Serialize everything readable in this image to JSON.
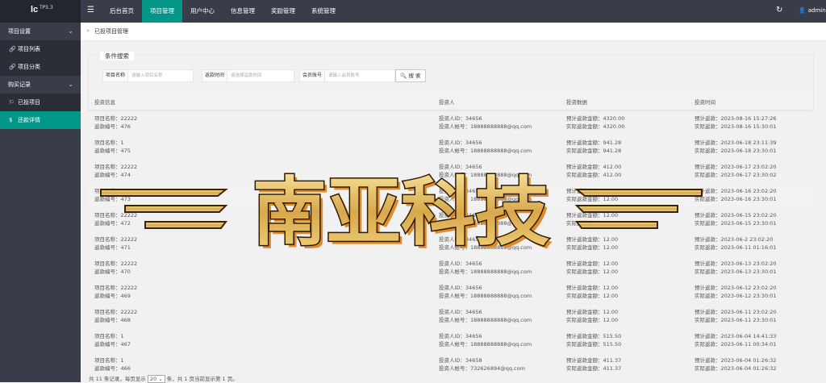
{
  "logo": {
    "text": "lc",
    "version": "TP5.3"
  },
  "nav": {
    "items": [
      "后台首页",
      "项目管理",
      "用户中心",
      "信息管理",
      "奖励管理",
      "系统管理"
    ],
    "active": 1
  },
  "user": {
    "name": "admin"
  },
  "sidebar": {
    "groups": [
      {
        "label": "项目设置"
      },
      {
        "label": "购买记录"
      }
    ],
    "items": [
      {
        "label": "项目列表",
        "icon": "link-icon"
      },
      {
        "label": "项目分类",
        "icon": "link-icon"
      },
      {
        "label": "已投项目",
        "icon": "flag-icon"
      },
      {
        "label": "还款详情",
        "icon": "dollar-circle-icon"
      }
    ],
    "active_item": 3
  },
  "breadcrumb": {
    "separator": "»",
    "text": "已投项目管理"
  },
  "search": {
    "legend": "条件搜索",
    "fields": [
      {
        "label": "项目名称",
        "placeholder": "请输入项目名称"
      },
      {
        "label": "返款时间",
        "placeholder": "请选择返款时间"
      },
      {
        "label": "会员账号",
        "placeholder": "请输入会员账号"
      }
    ],
    "button": "搜 索"
  },
  "table": {
    "headers": [
      "投资信息",
      "投资人",
      "投资数据",
      "投资时间"
    ],
    "rows": [
      {
        "name": "项目名称：22222",
        "no": "返款编号：476",
        "uid": "投资人ID：34656",
        "acct": "投资人帐号：18888888888@qq.com",
        "exp": "预计返款金额：4320.00",
        "act": "实际返款金额：4320.00",
        "et": "预计返款：2023-08-16 15:27:26",
        "at": "实际返款：2023-08-16 15:30:01"
      },
      {
        "name": "项目名称：1",
        "no": "返款编号：475",
        "uid": "投资人ID：34656",
        "acct": "投资人帐号：18888888888@qq.com",
        "exp": "预计返款金额：941.28",
        "act": "实际返款金额：941.28",
        "et": "预计返款：2023-06-18 23:11:39",
        "at": "实际返款：2023-06-18 23:30:01"
      },
      {
        "name": "项目名称：22222",
        "no": "返款编号：474",
        "uid": "投资人ID：34656",
        "acct": "投资人帐号：18888888888@qq.com",
        "exp": "预计返款金额：412.00",
        "act": "实际返款金额：412.00",
        "et": "预计返款：2023-06-17 23:02:20",
        "at": "实际返款：2023-06-17 23:30:02"
      },
      {
        "name": "项目名称：22222",
        "no": "返款编号：473",
        "uid": "投资人ID：34656",
        "acct": "投资人帐号：18888888888@qq.com",
        "exp": "预计返款金额：12.00",
        "act": "实际返款金额：12.00",
        "et": "预计返款：2023-06-16 23:02:20",
        "at": "实际返款：2023-06-16 23:30:01"
      },
      {
        "name": "项目名称：22222",
        "no": "返款编号：472",
        "uid": "投资人ID：34656",
        "acct": "投资人帐号：18888888888@qq.com",
        "exp": "预计返款金额：12.00",
        "act": "实际返款金额：12.00",
        "et": "预计返款：2023-06-15 23:02:20",
        "at": "实际返款：2023-06-15 23:30:01"
      },
      {
        "name": "项目名称：22222",
        "no": "返款编号：471",
        "uid": "投资人ID：34656",
        "acct": "投资人帐号：18888888888@qq.com",
        "exp": "预计返款金额：12.00",
        "act": "实际返款金额：12.00",
        "et": "预计返款：2023-06-2 23:02:20",
        "at": "实际返款：2023-06-11 01:16:01"
      },
      {
        "name": "项目名称：22222",
        "no": "返款编号：470",
        "uid": "投资人ID：34656",
        "acct": "投资人帐号：18888888888@qq.com",
        "exp": "预计返款金额：12.00",
        "act": "实际返款金额：12.00",
        "et": "预计返款：2023-06-13 23:02:20",
        "at": "实际返款：2023-06-13 23:30:01"
      },
      {
        "name": "项目名称：22222",
        "no": "返款编号：469",
        "uid": "投资人ID：34656",
        "acct": "投资人帐号：18888888888@qq.com",
        "exp": "预计返款金额：12.00",
        "act": "实际返款金额：12.00",
        "et": "预计返款：2023-06-12 23:02:20",
        "at": "实际返款：2023-06-12 23:30:01"
      },
      {
        "name": "项目名称：22222",
        "no": "返款编号：468",
        "uid": "投资人ID：34656",
        "acct": "投资人帐号：18888888888@qq.com",
        "exp": "预计返款金额：12.00",
        "act": "实际返款金额：12.00",
        "et": "预计返款：2023-06-11 23:02:20",
        "at": "实际返款：2023-06-11 23:30:01"
      },
      {
        "name": "项目名称：1",
        "no": "返款编号：467",
        "uid": "投资人ID：34656",
        "acct": "投资人帐号：18888888888@qq.com",
        "exp": "预计返款金额：515.50",
        "act": "实际返款金额：515.50",
        "et": "预计返款：2023-06-04 14:41:33",
        "at": "实际返款：2023-06-11 00:34:01"
      },
      {
        "name": "项目名称：1",
        "no": "返款编号：466",
        "uid": "投资人ID：34658",
        "acct": "投资人帐号：732626894@qq.com",
        "exp": "预计返款金额：411.37",
        "act": "实际返款金额：411.37",
        "et": "预计返款：2023-06-04 01:26:32",
        "at": "实际返款：2023-06-04 01:26:32"
      }
    ],
    "highlight_row": 3
  },
  "pagination": {
    "before": "共 11 条记录，每页显示",
    "page_size": "20",
    "after": "条，共 1 页当前显示第 1 页。"
  },
  "watermark": {
    "text": "南亚科技"
  },
  "colors": {
    "topbar": "#393d49",
    "accent": "#009688",
    "logo_bg": "#23262e",
    "sidebar_sub": "#2b2e37"
  }
}
